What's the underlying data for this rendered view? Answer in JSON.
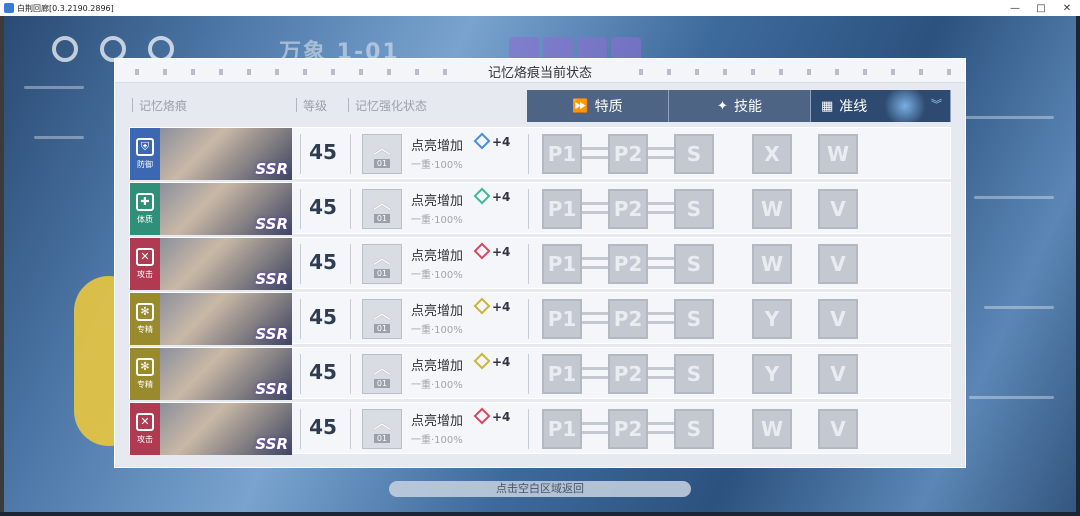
{
  "window": {
    "title": "白荆回廊[0.3.2190.2896]",
    "buttons": [
      "—",
      "□",
      "✕"
    ]
  },
  "hud": {
    "stage_text": "万象 1-01"
  },
  "panel": {
    "title": "记忆烙痕当前状态",
    "columns": [
      "记忆烙痕",
      "等级",
      "记忆强化状态"
    ],
    "tabs": [
      {
        "label": "特质",
        "icon": "⏩",
        "icon_name": "trait-icon"
      },
      {
        "label": "技能",
        "icon": "✦",
        "icon_name": "skill-icon"
      },
      {
        "label": "准线",
        "icon": "▦",
        "icon_name": "guideline-icon",
        "active": true
      }
    ]
  },
  "rows": [
    {
      "type_label": "防御",
      "type_color": "#3b67b3",
      "type_icon": "⛨",
      "rarity": "SSR",
      "level": "45",
      "enh_num": "01",
      "enh_label": "点亮增加",
      "enh_sub": "一重·100%",
      "bonus": "+4",
      "gem_color": "#4a8ee0",
      "nodes": [
        "P1",
        "P2",
        "S",
        "X",
        "W"
      ]
    },
    {
      "type_label": "体质",
      "type_color": "#2f8f78",
      "type_icon": "✚",
      "rarity": "SSR",
      "level": "45",
      "enh_num": "01",
      "enh_label": "点亮增加",
      "enh_sub": "一重·100%",
      "bonus": "+4",
      "gem_color": "#3fb89a",
      "nodes": [
        "P1",
        "P2",
        "S",
        "W",
        "V"
      ]
    },
    {
      "type_label": "攻击",
      "type_color": "#b03a52",
      "type_icon": "✕",
      "rarity": "SSR",
      "level": "45",
      "enh_num": "01",
      "enh_label": "点亮增加",
      "enh_sub": "一重·100%",
      "bonus": "+4",
      "gem_color": "#d9485e",
      "nodes": [
        "P1",
        "P2",
        "S",
        "W",
        "V"
      ]
    },
    {
      "type_label": "专精",
      "type_color": "#9a8a2e",
      "type_icon": "✻",
      "rarity": "SSR",
      "level": "45",
      "enh_num": "01",
      "enh_label": "点亮增加",
      "enh_sub": "一重·100%",
      "bonus": "+4",
      "gem_color": "#c9b63a",
      "nodes": [
        "P1",
        "P2",
        "S",
        "Y",
        "V"
      ]
    },
    {
      "type_label": "专精",
      "type_color": "#9a8a2e",
      "type_icon": "✻",
      "rarity": "SSR",
      "level": "45",
      "enh_num": "01",
      "enh_label": "点亮增加",
      "enh_sub": "一重·100%",
      "bonus": "+4",
      "gem_color": "#c9b63a",
      "nodes": [
        "P1",
        "P2",
        "S",
        "Y",
        "V"
      ]
    },
    {
      "type_label": "攻击",
      "type_color": "#b03a52",
      "type_icon": "✕",
      "rarity": "SSR",
      "level": "45",
      "enh_num": "01",
      "enh_label": "点亮增加",
      "enh_sub": "一重·100%",
      "bonus": "+4",
      "gem_color": "#d9485e",
      "nodes": [
        "P1",
        "P2",
        "S",
        "W",
        "V"
      ]
    }
  ],
  "footer": {
    "hint": "点击空白区域返回"
  }
}
